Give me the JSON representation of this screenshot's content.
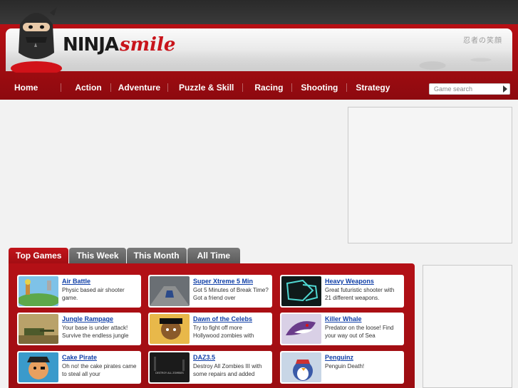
{
  "site": {
    "logo_ninja": "NINJA",
    "logo_smile": "smile",
    "japanese_tagline": "忍者の笑顔"
  },
  "nav": {
    "items": [
      "Home",
      "Action",
      "Adventure",
      "Puzzle & Skill",
      "Racing",
      "Shooting",
      "Strategy"
    ]
  },
  "search": {
    "placeholder": "Game search"
  },
  "tabs": [
    "Top Games",
    "This Week",
    "This Month",
    "All Time"
  ],
  "games": [
    {
      "title": "Air Battle",
      "desc": "Physic based air shooter game."
    },
    {
      "title": "Super Xtreme 5 Min",
      "desc": "Got 5 Minutes of Break Time? Got a friend over"
    },
    {
      "title": "Heavy Weapons",
      "desc": "Great futuristic shooter with 21 different weapons."
    },
    {
      "title": "Jungle Rampage",
      "desc": "Your base is under attack! Survive the endless jungle"
    },
    {
      "title": "Dawn of the Celebs",
      "desc": "Try to fight off more Hollywood zombies with"
    },
    {
      "title": "Killer Whale",
      "desc": "Predator on the loose! Find your way out of Sea"
    },
    {
      "title": "Cake Pirate",
      "desc": "Oh no! the cake pirates came to steal all your"
    },
    {
      "title": "DAZ3.5",
      "desc": "Destroy All Zombies III with some repairs and added"
    },
    {
      "title": "Penguinz",
      "desc": "Penguin Death!"
    }
  ],
  "daz_thumb_text": "DESTROY ALL ZOMBIES"
}
